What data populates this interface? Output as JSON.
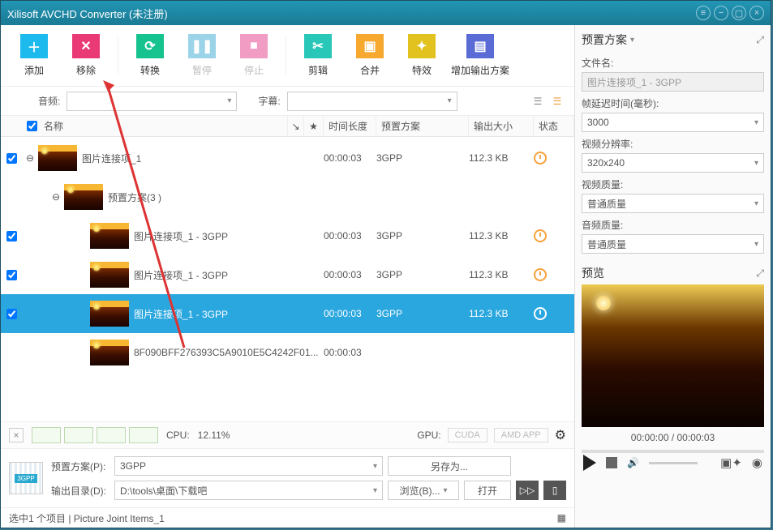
{
  "window_title": "Xilisoft AVCHD Converter (未注册)",
  "toolbar": {
    "add": "添加",
    "remove": "移除",
    "convert": "转换",
    "pause": "暂停",
    "stop": "停止",
    "cut": "剪辑",
    "merge": "合并",
    "effects": "特效",
    "addprofile": "增加输出方案"
  },
  "selectors": {
    "audio_label": "音频:",
    "subtitle_label": "字幕:"
  },
  "columns": {
    "name": "名称",
    "duration": "时间长度",
    "preset": "预置方案",
    "size": "输出大小",
    "status": "状态"
  },
  "rows": [
    {
      "indent": 0,
      "ck": true,
      "exp": "⊖",
      "name": "图片连接项_1",
      "dur": "00:00:03",
      "preset": "3GPP",
      "size": "112.3 KB",
      "clock": true
    },
    {
      "indent": 1,
      "exp": "⊖",
      "name": "预置方案(3 )"
    },
    {
      "indent": 2,
      "ck": true,
      "name": "图片连接项_1 - 3GPP",
      "dur": "00:00:03",
      "preset": "3GPP",
      "size": "112.3 KB",
      "clock": true
    },
    {
      "indent": 2,
      "ck": true,
      "name": "图片连接项_1 - 3GPP",
      "dur": "00:00:03",
      "preset": "3GPP",
      "size": "112.3 KB",
      "clock": true
    },
    {
      "indent": 2,
      "ck": true,
      "sel": true,
      "name": "图片连接项_1 - 3GPP",
      "dur": "00:00:03",
      "preset": "3GPP",
      "size": "112.3 KB",
      "clock": true
    },
    {
      "indent": 2,
      "name": "8F090BFF276393C5A9010E5C4242F01...",
      "dur": "00:00:03"
    }
  ],
  "cpu": {
    "label": "CPU:",
    "value": "12.11%",
    "gpu": "GPU:",
    "cuda": "CUDA",
    "amd": "AMD APP"
  },
  "output": {
    "profile_label": "预置方案(P):",
    "profile_value": "3GPP",
    "saveas": "另存为...",
    "dir_label": "输出目录(D):",
    "dir_value": "D:\\tools\\桌面\\下载吧",
    "browse": "浏览(B)...",
    "open": "打开"
  },
  "statusbar": "选中1 个项目 | Picture Joint Items_1",
  "panel": {
    "preset_title": "预置方案",
    "filename_label": "文件名:",
    "filename_value": "图片连接项_1 - 3GPP",
    "delay_label": "帧延迟时间(毫秒):",
    "delay_value": "3000",
    "res_label": "视频分辨率:",
    "res_value": "320x240",
    "vq_label": "视频质量:",
    "vq_value": "普通质量",
    "aq_label": "音频质量:",
    "aq_value": "普通质量",
    "preview_title": "预览",
    "time": "00:00:00 / 00:00:03"
  }
}
